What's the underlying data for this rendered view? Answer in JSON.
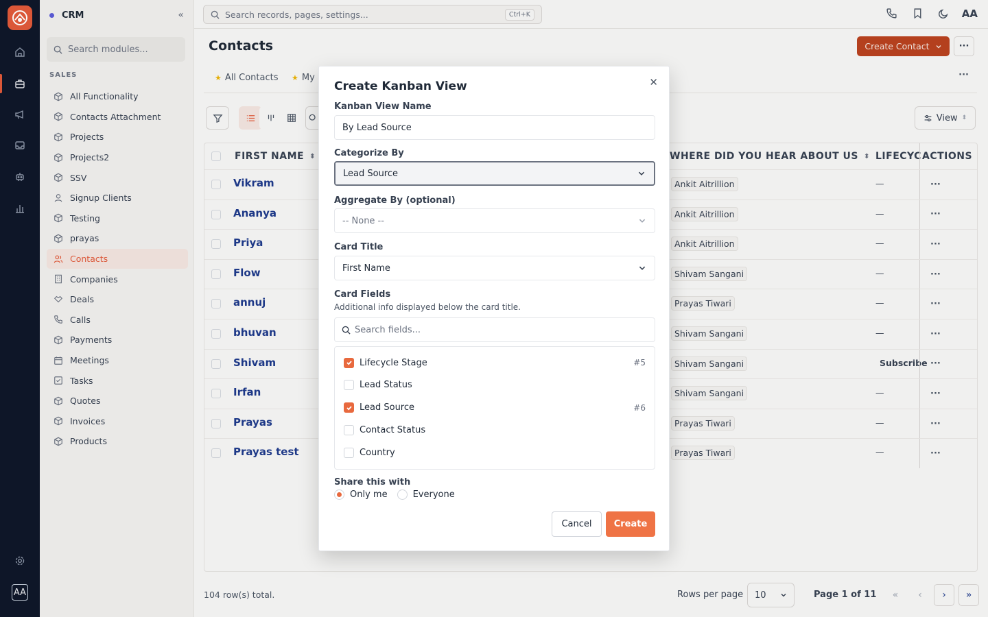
{
  "app": {
    "module_title": "CRM",
    "user_initials": "AA"
  },
  "colors": {
    "accent": "#e0593a",
    "rail_bg": "#0f1729",
    "link": "#1e3a8a",
    "checkbox_on": "#e8693e"
  },
  "sidebar": {
    "search_placeholder": "Search modules...",
    "section_label": "SALES",
    "items": [
      {
        "label": "All Functionality",
        "icon": "cube-icon"
      },
      {
        "label": "Contacts Attachment",
        "icon": "cube-icon"
      },
      {
        "label": "Projects",
        "icon": "cube-icon"
      },
      {
        "label": "Projects2",
        "icon": "cube-icon"
      },
      {
        "label": "SSV",
        "icon": "cube-icon"
      },
      {
        "label": "Signup Clients",
        "icon": "user-icon"
      },
      {
        "label": "Testing",
        "icon": "cube-icon"
      },
      {
        "label": "prayas",
        "icon": "cube-icon"
      },
      {
        "label": "Contacts",
        "icon": "users-icon",
        "active": true
      },
      {
        "label": "Companies",
        "icon": "building-icon"
      },
      {
        "label": "Deals",
        "icon": "handshake-icon"
      },
      {
        "label": "Calls",
        "icon": "phone-icon"
      },
      {
        "label": "Payments",
        "icon": "cube-icon"
      },
      {
        "label": "Meetings",
        "icon": "calendar-icon"
      },
      {
        "label": "Tasks",
        "icon": "task-icon"
      },
      {
        "label": "Quotes",
        "icon": "cube-icon"
      },
      {
        "label": "Invoices",
        "icon": "cube-icon"
      },
      {
        "label": "Products",
        "icon": "cube-icon"
      }
    ]
  },
  "topbar": {
    "search_placeholder": "Search records, pages, settings...",
    "shortcut": "Ctrl+K"
  },
  "main": {
    "title": "Contacts",
    "create_button": "Create Contact",
    "more": "···",
    "tabs": [
      "All Contacts",
      "My"
    ],
    "view_button": "View",
    "columns": {
      "first_name": "FIRST NAME",
      "hear": "WHERE DID YOU HEAR ABOUT US",
      "lifecycle": "LIFECYC",
      "actions": "ACTIONS"
    },
    "rows": [
      {
        "first_name": "Vikram",
        "hear": "Ankit Aitrillion",
        "lifecycle": "—"
      },
      {
        "first_name": "Ananya",
        "hear": "Ankit Aitrillion",
        "lifecycle": "—"
      },
      {
        "first_name": "Priya",
        "hear": "Ankit Aitrillion",
        "lifecycle": "—"
      },
      {
        "first_name": "Flow",
        "hear": "Shivam Sangani",
        "lifecycle": "—"
      },
      {
        "first_name": "annuj",
        "hear": "Prayas Tiwari",
        "lifecycle": "—"
      },
      {
        "first_name": "bhuvan",
        "hear": "Shivam Sangani",
        "lifecycle": "—"
      },
      {
        "first_name": "Shivam",
        "hear": "Shivam Sangani",
        "lifecycle": "Subscribe"
      },
      {
        "first_name": "Irfan",
        "hear": "Shivam Sangani",
        "lifecycle": "—"
      },
      {
        "first_name": "Prayas",
        "hear": "Prayas Tiwari",
        "lifecycle": "—"
      },
      {
        "first_name": "Prayas test",
        "hear": "Prayas Tiwari",
        "lifecycle": "—"
      }
    ],
    "row_action": "···"
  },
  "footer": {
    "total": "104 row(s) total.",
    "rows_per_page_label": "Rows per page",
    "rows_per_page": "10",
    "page_info": "Page 1 of 11"
  },
  "modal": {
    "title": "Create Kanban View",
    "name_label": "Kanban View Name",
    "name_value": "By Lead Source",
    "categorize_label": "Categorize By",
    "categorize_value": "Lead Source",
    "aggregate_label": "Aggregate By (optional)",
    "aggregate_value": "-- None --",
    "card_title_label": "Card Title",
    "card_title_value": "First Name",
    "card_fields_label": "Card Fields",
    "card_fields_hint": "Additional info displayed below the card title.",
    "search_fields_placeholder": "Search fields...",
    "fields": [
      {
        "label": "Lifecycle Stage",
        "checked": true,
        "order": "#5"
      },
      {
        "label": "Lead Status",
        "checked": false,
        "order": ""
      },
      {
        "label": "Lead Source",
        "checked": true,
        "order": "#6"
      },
      {
        "label": "Contact Status",
        "checked": false,
        "order": ""
      },
      {
        "label": "Country",
        "checked": false,
        "order": ""
      }
    ],
    "share_label": "Share this with",
    "share_options": [
      {
        "label": "Only me",
        "selected": true
      },
      {
        "label": "Everyone",
        "selected": false
      }
    ],
    "cancel": "Cancel",
    "create": "Create"
  }
}
